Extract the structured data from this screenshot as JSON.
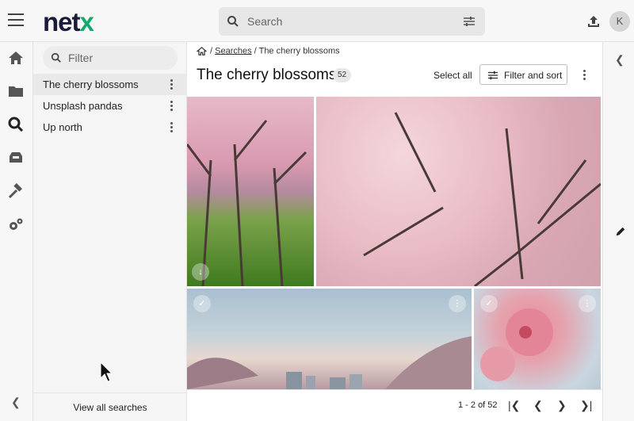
{
  "app": {
    "logo_net": "net",
    "logo_x": "x"
  },
  "header": {
    "search_placeholder": "Search",
    "user_initial": "K"
  },
  "sidebar_icons": [
    "home-icon",
    "folder-icon",
    "search-icon",
    "inbox-icon",
    "hammer-icon",
    "gears-icon"
  ],
  "searches_panel": {
    "filter_placeholder": "Filter",
    "items": [
      {
        "label": "The cherry blossoms",
        "active": true
      },
      {
        "label": "Unsplash pandas",
        "active": false
      },
      {
        "label": "Up north",
        "active": false
      }
    ],
    "view_all_label": "View all searches"
  },
  "main": {
    "breadcrumb": {
      "link": "Searches",
      "current": "The cherry blossoms",
      "sep": "/"
    },
    "title": "The cherry blossoms",
    "count": "52",
    "select_all": "Select all",
    "filter_sort": "Filter and sort"
  },
  "pagination": {
    "range": "1 - 2 of 52"
  },
  "colors": {
    "brand_navy": "#1a1a3a",
    "brand_green": "#12a96c"
  }
}
